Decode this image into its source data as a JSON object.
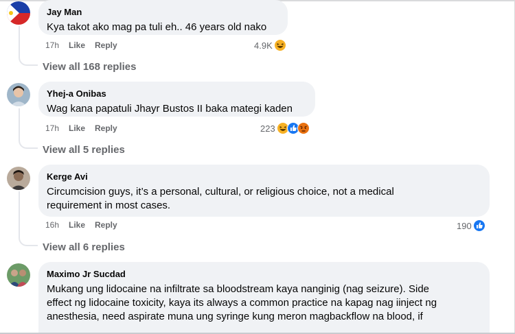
{
  "comments": [
    {
      "author": "Jay Man",
      "text": "Kya takot ako mag pa tuli eh.. 46 years old nako",
      "time": "17h",
      "like_label": "Like",
      "reply_label": "Reply",
      "reaction_count": "4.9K",
      "reactions": [
        "haha-icon"
      ],
      "view_replies": "View all 168 replies"
    },
    {
      "author": "Yhej-a Onibas",
      "text": "Wag kana papatuli Jhayr Bustos II baka mategi kaden",
      "time": "17h",
      "like_label": "Like",
      "reply_label": "Reply",
      "reaction_count": "223",
      "reactions": [
        "haha-icon",
        "like-icon",
        "angry-icon"
      ],
      "view_replies": "View all 5 replies"
    },
    {
      "author": "Kerge Avi",
      "text_lines": [
        "Circumcision guys, it’s a personal, cultural, or religious choice, not a medical",
        "requirement in most cases."
      ],
      "time": "16h",
      "like_label": "Like",
      "reply_label": "Reply",
      "reaction_count": "190",
      "reactions": [
        "like-icon"
      ],
      "view_replies": "View all 6 replies"
    },
    {
      "author": "Maximo Jr Sucdad",
      "text_lines": [
        "Mukang ung lidocaine na infiltrate sa bloodstream kaya nanginig (nag seizure). Side",
        "effect ng lidocaine toxicity, kaya its always a common practice na kapag nag iinject ng",
        "anesthesia, need aspirate muna ung syringe kung meron magbackflow na blood, if"
      ]
    }
  ],
  "colors": {
    "bubble": "#f0f2f5",
    "muted": "#65676b",
    "like_blue": "#1877f2",
    "haha_yellow": "#f7b125",
    "angry_red": "#e9710f"
  }
}
